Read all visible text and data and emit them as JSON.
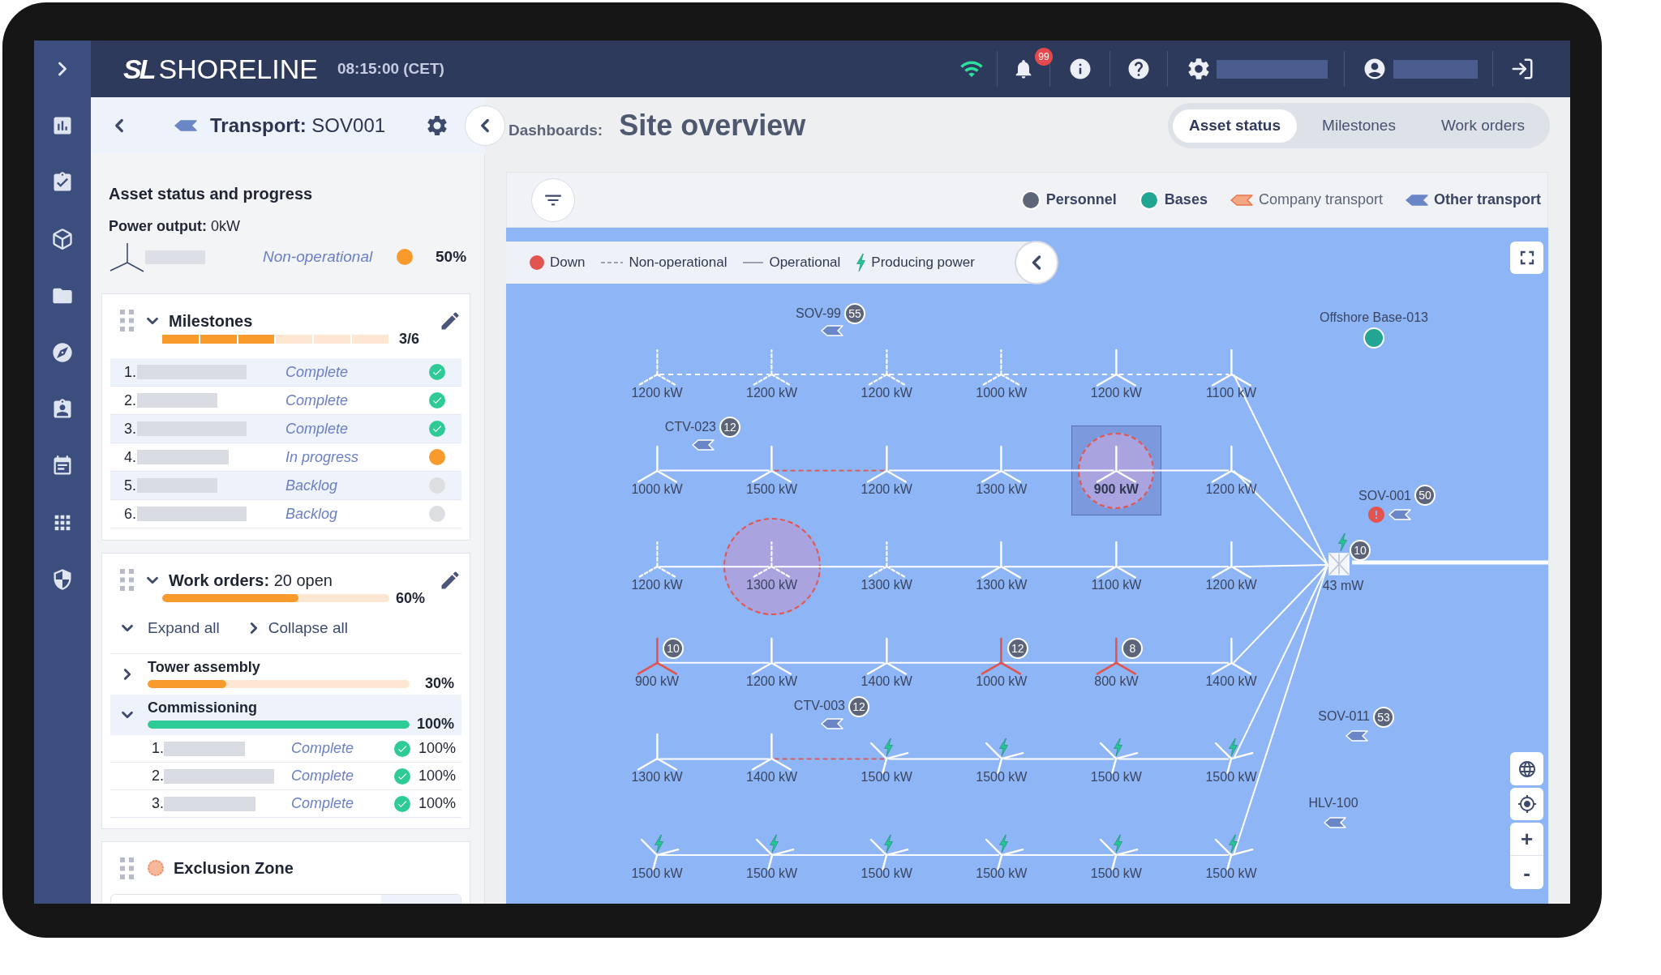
{
  "app": {
    "logo_mark": "SL",
    "logo_name": "SHORELINE",
    "clock": "08:15:00 (CET)",
    "notifications": "99"
  },
  "transport": {
    "title": "**Transport:** SOV001"
  },
  "dashboard": {
    "label": "Dashboards:",
    "title": "Site overview"
  },
  "tabs": [
    {
      "label": "Asset status",
      "selected": true
    },
    {
      "label": "Milestones",
      "selected": false
    },
    {
      "label": "Work orders",
      "selected": false
    }
  ],
  "asset": {
    "title": "Asset status and progress",
    "power_output": "**Power output:** 0kW",
    "status": {
      "label": "Non-operational",
      "kind": "in_progress"
    },
    "percent": "50%"
  },
  "milestones": {
    "title": "Milestones",
    "expanded": true,
    "count": "3/6",
    "level": 0.5,
    "items": [
      {
        "number": "1.",
        "status": "Complete",
        "kind": "complete"
      },
      {
        "number": "2.",
        "status": "Complete",
        "kind": "complete"
      },
      {
        "number": "3.",
        "status": "Complete",
        "kind": "complete"
      },
      {
        "number": "4.",
        "status": "In progress",
        "kind": "in_progress"
      },
      {
        "number": "5.",
        "status": "Backlog",
        "kind": "backlog"
      },
      {
        "number": "6.",
        "status": "Backlog",
        "kind": "backlog"
      }
    ]
  },
  "work_orders": {
    "title": "**Work orders:** 20 open",
    "expanded": true,
    "level": 0.6,
    "percent": "60%",
    "expand_all": "Expand all",
    "collapse_all": "Collapse all",
    "groups": [
      {
        "name": "Tower assembly",
        "expanded": false,
        "level": 0.3,
        "percent": "30%"
      },
      {
        "name": "Commissioning",
        "expanded": true,
        "level": 1,
        "percent": "100%",
        "items": [
          {
            "number": "1.",
            "status": "Complete",
            "kind": "complete",
            "percent": "100%"
          },
          {
            "number": "2.",
            "status": "Complete",
            "kind": "complete",
            "percent": "100%"
          },
          {
            "number": "3.",
            "status": "Complete",
            "kind": "complete",
            "percent": "100%"
          }
        ]
      }
    ]
  },
  "exclusion_zone": {
    "title": "Exclusion Zone"
  },
  "map": {
    "layers": [
      {
        "label": "Personnel",
        "kind": "personnel",
        "selected": true
      },
      {
        "label": "Bases",
        "kind": "base",
        "selected": true
      },
      {
        "label": "Company transport",
        "kind": "company_transport",
        "selected": false
      },
      {
        "label": "Other transport",
        "kind": "other_transport",
        "selected": true
      }
    ],
    "legend": [
      {
        "label": "Down",
        "kind": "down"
      },
      {
        "label": "Non-operational",
        "kind": "non_operational"
      },
      {
        "label": "Operational",
        "kind": "operational"
      },
      {
        "label": "Producing power",
        "kind": "producing"
      }
    ],
    "rows": [
      {
        "links": [
          {
            "kind": "non_operational"
          },
          {
            "kind": "non_operational"
          },
          {
            "kind": "non_operational"
          },
          {
            "kind": "non_operational"
          },
          {
            "kind": "non_operational"
          }
        ],
        "feeder": {
          "kind": "operational"
        },
        "turbines": [
          {
            "label": "1200 kW",
            "kind": "non_operational",
            "selected": false,
            "exclusion_zone": false
          },
          {
            "label": "1200 kW",
            "kind": "non_operational",
            "selected": false,
            "exclusion_zone": false
          },
          {
            "label": "1200 kW",
            "kind": "non_operational",
            "selected": false,
            "exclusion_zone": false
          },
          {
            "label": "1000 kW",
            "kind": "non_operational",
            "selected": false,
            "exclusion_zone": false
          },
          {
            "label": "1200 kW",
            "kind": "operational",
            "selected": false,
            "exclusion_zone": false
          },
          {
            "label": "1100 kW",
            "kind": "operational",
            "selected": false,
            "exclusion_zone": false
          }
        ]
      },
      {
        "links": [
          {
            "kind": "operational"
          },
          {
            "kind": "down"
          },
          {
            "kind": "operational"
          },
          {
            "kind": "operational"
          },
          {
            "kind": "operational"
          }
        ],
        "feeder": {
          "kind": "operational"
        },
        "turbines": [
          {
            "label": "1000 kW",
            "kind": "operational",
            "selected": false,
            "exclusion_zone": false
          },
          {
            "label": "1500 kW",
            "kind": "operational",
            "selected": false,
            "exclusion_zone": false
          },
          {
            "label": "1200 kW",
            "kind": "operational",
            "selected": false,
            "exclusion_zone": false
          },
          {
            "label": "1300 kW",
            "kind": "operational",
            "selected": false,
            "exclusion_zone": false
          },
          {
            "label": "900 kW",
            "kind": "operational",
            "selected": true,
            "exclusion_zone": true
          },
          {
            "label": "1200 kW",
            "kind": "operational",
            "selected": false,
            "exclusion_zone": false
          }
        ]
      },
      {
        "links": [
          {
            "kind": "operational"
          },
          {
            "kind": "operational"
          },
          {
            "kind": "operational"
          },
          {
            "kind": "operational"
          },
          {
            "kind": "operational"
          }
        ],
        "feeder": {
          "kind": "operational"
        },
        "turbines": [
          {
            "label": "1200 kW",
            "kind": "non_operational",
            "selected": false,
            "exclusion_zone": false
          },
          {
            "label": "1300 kW",
            "kind": "non_operational",
            "selected": false,
            "exclusion_zone": true
          },
          {
            "label": "1300 kW",
            "kind": "non_operational",
            "selected": false,
            "exclusion_zone": false
          },
          {
            "label": "1300 kW",
            "kind": "operational",
            "selected": false,
            "exclusion_zone": false
          },
          {
            "label": "1100 kW",
            "kind": "operational",
            "selected": false,
            "exclusion_zone": false
          },
          {
            "label": "1200 kW",
            "kind": "operational",
            "selected": false,
            "exclusion_zone": false
          }
        ]
      },
      {
        "links": [
          {
            "kind": "operational"
          },
          {
            "kind": "operational"
          },
          {
            "kind": "operational"
          },
          {
            "kind": "operational"
          },
          {
            "kind": "operational"
          }
        ],
        "feeder": {
          "kind": "operational"
        },
        "turbines": [
          {
            "label": "900 kW",
            "kind": "down",
            "selected": false,
            "exclusion_zone": false,
            "personnel": "10"
          },
          {
            "label": "1200 kW",
            "kind": "operational",
            "selected": false,
            "exclusion_zone": false
          },
          {
            "label": "1400 kW",
            "kind": "operational",
            "selected": false,
            "exclusion_zone": false
          },
          {
            "label": "1000 kW",
            "kind": "down",
            "selected": false,
            "exclusion_zone": false,
            "personnel": "12"
          },
          {
            "label": "800 kW",
            "kind": "down",
            "selected": false,
            "exclusion_zone": false,
            "personnel": "8"
          },
          {
            "label": "1400 kW",
            "kind": "operational",
            "selected": false,
            "exclusion_zone": false
          }
        ]
      },
      {
        "links": [
          {
            "kind": "operational"
          },
          {
            "kind": "down"
          },
          {
            "kind": "operational"
          },
          {
            "kind": "operational"
          },
          {
            "kind": "operational"
          }
        ],
        "feeder": {
          "kind": "operational"
        },
        "turbines": [
          {
            "label": "1300 kW",
            "kind": "operational",
            "selected": false,
            "exclusion_zone": false
          },
          {
            "label": "1400 kW",
            "kind": "operational",
            "selected": false,
            "exclusion_zone": false
          },
          {
            "label": "1500 kW",
            "kind": "producing",
            "selected": false,
            "exclusion_zone": false
          },
          {
            "label": "1500 kW",
            "kind": "producing",
            "selected": false,
            "exclusion_zone": false
          },
          {
            "label": "1500 kW",
            "kind": "producing",
            "selected": false,
            "exclusion_zone": false
          },
          {
            "label": "1500 kW",
            "kind": "producing",
            "selected": false,
            "exclusion_zone": false
          }
        ]
      },
      {
        "links": [
          {
            "kind": "operational"
          },
          {
            "kind": "operational"
          },
          {
            "kind": "operational"
          },
          {
            "kind": "operational"
          },
          {
            "kind": "operational"
          }
        ],
        "feeder": {
          "kind": "operational"
        },
        "turbines": [
          {
            "label": "1500 kW",
            "kind": "producing",
            "selected": false,
            "exclusion_zone": false
          },
          {
            "label": "1500 kW",
            "kind": "producing",
            "selected": false,
            "exclusion_zone": false
          },
          {
            "label": "1500 kW",
            "kind": "producing",
            "selected": false,
            "exclusion_zone": false
          },
          {
            "label": "1500 kW",
            "kind": "producing",
            "selected": false,
            "exclusion_zone": false
          },
          {
            "label": "1500 kW",
            "kind": "producing",
            "selected": false,
            "exclusion_zone": false
          },
          {
            "label": "1500 kW",
            "kind": "producing",
            "selected": false,
            "exclusion_zone": false
          }
        ]
      }
    ],
    "substation": {
      "label": "43 mW",
      "personnel": "10",
      "producing": true
    },
    "bases": [
      {
        "name": "Offshore Base-013"
      }
    ],
    "vessels": [
      {
        "name": "SOV-99",
        "personnel": "55",
        "alert": false
      },
      {
        "name": "CTV-023",
        "personnel": "12",
        "alert": false
      },
      {
        "name": "SOV-001",
        "personnel": "50",
        "alert": true
      },
      {
        "name": "CTV-003",
        "personnel": "12",
        "alert": false
      },
      {
        "name": "SOV-011",
        "personnel": "53",
        "alert": false
      },
      {
        "name": "HLV-100",
        "alert": false
      }
    ],
    "zoom_in": "+",
    "zoom_out": "-"
  }
}
